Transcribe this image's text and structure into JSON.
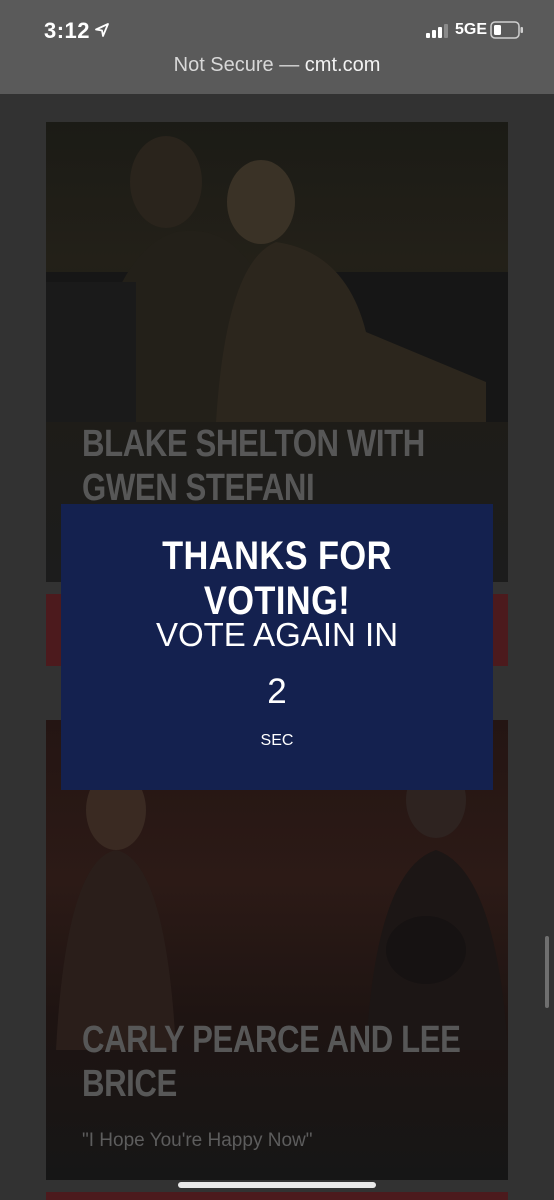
{
  "status_bar": {
    "time": "3:12",
    "network": "5GE",
    "icons": [
      "location-arrow-icon",
      "signal-bars-icon",
      "battery-icon"
    ]
  },
  "url_bar": {
    "security": "Not Secure —",
    "domain": "cmt.com"
  },
  "cards": [
    {
      "title_line1": "BLAKE SHELTON WITH",
      "title_line2": "GWEN STEFANI",
      "subtitle": ""
    },
    {
      "title_line1": "CARLY PEARCE AND LEE",
      "title_line2": "BRICE",
      "subtitle": "\"I Hope You're Happy Now\""
    }
  ],
  "modal": {
    "title": "THANKS FOR VOTING!",
    "subtitle": "VOTE AGAIN IN",
    "countdown": "2",
    "unit": "SEC"
  },
  "colors": {
    "modal_bg": "#14214f",
    "vote_bar": "#4c1a1d",
    "chrome": "#5a5a5a"
  }
}
